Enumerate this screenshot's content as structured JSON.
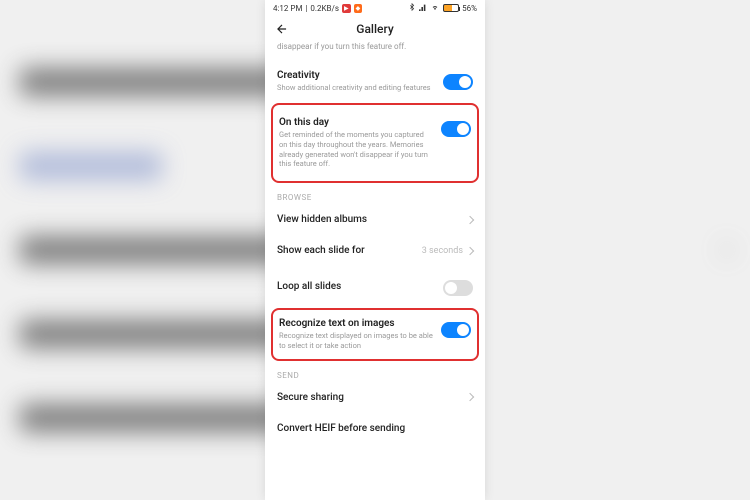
{
  "status": {
    "time": "4:12 PM",
    "speed": "0.2KB/s",
    "battery_pct": "56%"
  },
  "header": {
    "title": "Gallery"
  },
  "truncated_top": "disappear if you turn this feature off.",
  "settings": {
    "creativity": {
      "title": "Creativity",
      "desc": "Show additional creativity and editing features"
    },
    "on_this_day": {
      "title": "On this day",
      "desc": "Get reminded of the moments you captured on this day throughout the years. Memories already generated won't disappear if you turn this feature off."
    },
    "recognize_text": {
      "title": "Recognize text on images",
      "desc": "Recognize text displayed on images to be able to select it or take action"
    }
  },
  "sections": {
    "browse": "BROWSE",
    "send": "SEND"
  },
  "nav": {
    "view_hidden": "View hidden albums",
    "show_slide": "Show each slide for",
    "show_slide_value": "3 seconds",
    "loop_slides": "Loop all slides",
    "secure_sharing": "Secure sharing",
    "convert_heif": "Convert HEIF before sending"
  }
}
